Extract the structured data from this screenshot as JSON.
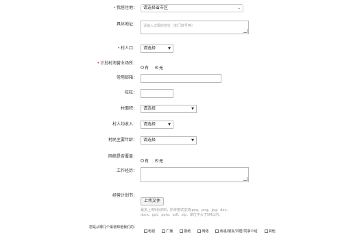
{
  "form": {
    "location": {
      "label": "我居住地：",
      "value": "请选择省市区"
    },
    "address": {
      "label": "具体地址：",
      "placeholder": "请输入详细的地址（如门牌号等）"
    },
    "village_population": {
      "label": "村人口：",
      "value": "请选择"
    },
    "plan_business": {
      "label": "计划村淘营业场所：",
      "option_yes": "有",
      "option_no": "无",
      "selected": "无"
    },
    "email": {
      "label": "常用邮箱：",
      "value": ""
    },
    "qq": {
      "label": "旺旺：",
      "value": ""
    },
    "village_area": {
      "label": "村面积：",
      "value": "请选择"
    },
    "income": {
      "label": "村人均收入：",
      "value": "请选择"
    },
    "age": {
      "label": "村民主要年龄：",
      "value": "请选择"
    },
    "network": {
      "label": "网络是否覆盖：",
      "option_yes": "有",
      "option_no": "无",
      "selected": "无"
    },
    "experience": {
      "label": "工作经历：",
      "value": ""
    },
    "upload": {
      "label": "经营计划书：",
      "button": "上传文件",
      "hint": "最多上传5份资料，所传格式支持jpeg、png、jpg、doc、docx、ppt、pptx、pdf、zip，单位不大于5M以内。"
    },
    "channels": {
      "label": "您是从哪几个渠道知道我们的：",
      "options": [
        "电视",
        "广播",
        "报纸",
        "网络",
        "亲戚/朋友/邻居/同事介绍",
        "其他"
      ]
    }
  },
  "colors": {
    "required": "#e02b2b",
    "border": "#b9b9b9"
  }
}
